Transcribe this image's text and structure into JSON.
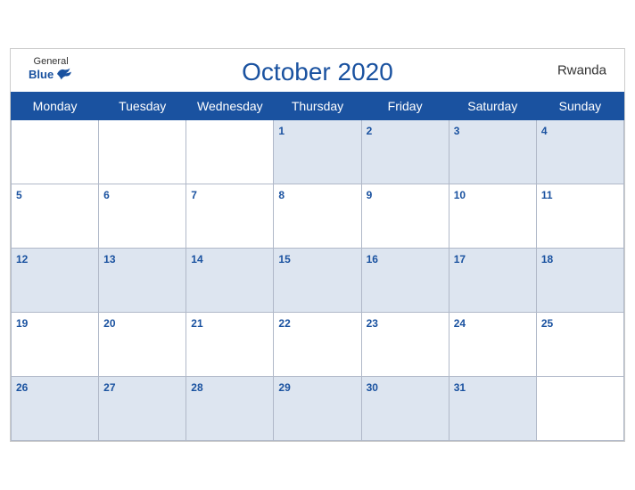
{
  "header": {
    "logo_general": "General",
    "logo_blue": "Blue",
    "title": "October 2020",
    "country": "Rwanda"
  },
  "weekdays": [
    "Monday",
    "Tuesday",
    "Wednesday",
    "Thursday",
    "Friday",
    "Saturday",
    "Sunday"
  ],
  "weeks": [
    [
      null,
      null,
      null,
      1,
      2,
      3,
      4
    ],
    [
      5,
      6,
      7,
      8,
      9,
      10,
      11
    ],
    [
      12,
      13,
      14,
      15,
      16,
      17,
      18
    ],
    [
      19,
      20,
      21,
      22,
      23,
      24,
      25
    ],
    [
      26,
      27,
      28,
      29,
      30,
      31,
      null
    ]
  ]
}
